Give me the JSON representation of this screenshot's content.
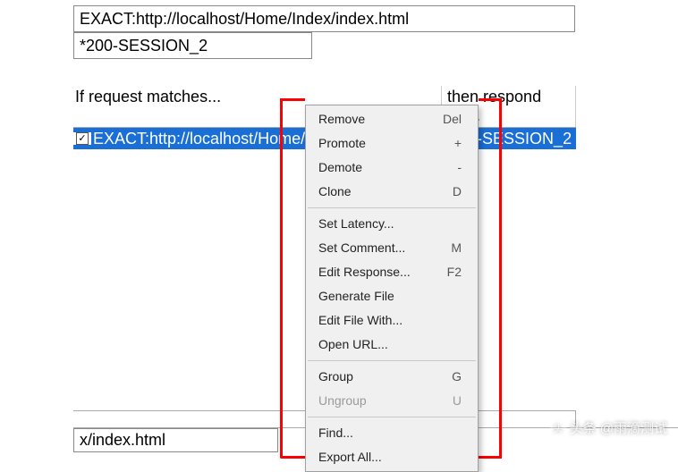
{
  "inputs": {
    "url": "EXACT:http://localhost/Home/Index/index.html",
    "session": "*200-SESSION_2"
  },
  "table": {
    "headers": {
      "match": "If request matches...",
      "respond": "then respond with."
    },
    "row": {
      "checked": "✓",
      "match": "EXACT:http://localhost/Home/Index/ind",
      "respond": "*200-SESSION_2"
    }
  },
  "bottomInput": "x/index.html",
  "menu": [
    {
      "type": "item",
      "label": "Remove",
      "shortcut": "Del",
      "disabled": false
    },
    {
      "type": "item",
      "label": "Promote",
      "shortcut": "+",
      "disabled": false
    },
    {
      "type": "item",
      "label": "Demote",
      "shortcut": "-",
      "disabled": false
    },
    {
      "type": "item",
      "label": "Clone",
      "shortcut": "D",
      "disabled": false
    },
    {
      "type": "sep"
    },
    {
      "type": "item",
      "label": "Set Latency...",
      "shortcut": "",
      "disabled": false
    },
    {
      "type": "item",
      "label": "Set Comment...",
      "shortcut": "M",
      "disabled": false
    },
    {
      "type": "item",
      "label": "Edit Response...",
      "shortcut": "F2",
      "disabled": false
    },
    {
      "type": "item",
      "label": "Generate File",
      "shortcut": "",
      "disabled": false
    },
    {
      "type": "item",
      "label": "Edit File With...",
      "shortcut": "",
      "disabled": false
    },
    {
      "type": "item",
      "label": "Open URL...",
      "shortcut": "",
      "disabled": false
    },
    {
      "type": "sep"
    },
    {
      "type": "item",
      "label": "Group",
      "shortcut": "G",
      "disabled": false
    },
    {
      "type": "item",
      "label": "Ungroup",
      "shortcut": "U",
      "disabled": true
    },
    {
      "type": "sep"
    },
    {
      "type": "item",
      "label": "Find...",
      "shortcut": "",
      "disabled": false
    },
    {
      "type": "item",
      "label": "Export All...",
      "shortcut": "",
      "disabled": false
    }
  ],
  "watermark": {
    "prefix": "头条",
    "author": "@雨滴测试"
  }
}
